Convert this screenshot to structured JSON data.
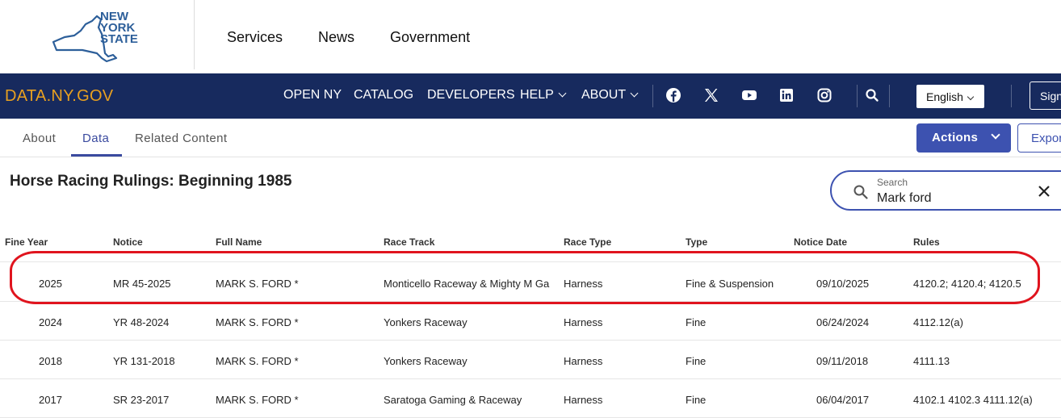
{
  "state_header": {
    "logo_lines": [
      "NEW",
      "YORK",
      "STATE"
    ],
    "nav": [
      "Services",
      "News",
      "Government"
    ]
  },
  "navbar": {
    "brand": "DATA.NY.GOV",
    "links": [
      "OPEN NY",
      "CATALOG",
      "DEVELOPERS",
      "HELP",
      "ABOUT"
    ],
    "social_icons": [
      "facebook-icon",
      "x-icon",
      "youtube-icon",
      "linkedin-icon",
      "instagram-icon"
    ],
    "language": "English",
    "signin": "Sign"
  },
  "tabs": {
    "items": [
      "About",
      "Data",
      "Related Content"
    ],
    "active": "Data",
    "actions_label": "Actions",
    "export_label": "Expor"
  },
  "page": {
    "title": "Horse Racing Rulings: Beginning 1985"
  },
  "search": {
    "label": "Search",
    "value": "Mark ford"
  },
  "table": {
    "columns": [
      "Fine Year",
      "Notice",
      "Full Name",
      "Race Track",
      "Race Type",
      "Type",
      "Notice Date",
      "Rules"
    ],
    "rows": [
      [
        "2025",
        "MR 45-2025",
        "MARK S. FORD *",
        "Monticello Raceway & Mighty M Ga",
        "Harness",
        "Fine & Suspension",
        "09/10/2025",
        "4120.2; 4120.4; 4120.5"
      ],
      [
        "2024",
        "YR 48-2024",
        "MARK S. FORD *",
        "Yonkers Raceway",
        "Harness",
        "Fine",
        "06/24/2024",
        "4112.12(a)"
      ],
      [
        "2018",
        "YR 131-2018",
        "MARK S. FORD *",
        "Yonkers Raceway",
        "Harness",
        "Fine",
        "09/11/2018",
        "4111.13"
      ],
      [
        "2017",
        "SR 23-2017",
        "MARK S. FORD *",
        "Saratoga Gaming & Raceway",
        "Harness",
        "Fine",
        "06/04/2017",
        "4102.1 4102.3 4111.12(a)"
      ]
    ]
  },
  "colors": {
    "navy": "#172a5e",
    "brand_orange": "#e8a020",
    "accent_blue": "#3d52b0",
    "highlight_red": "#e0141e"
  }
}
